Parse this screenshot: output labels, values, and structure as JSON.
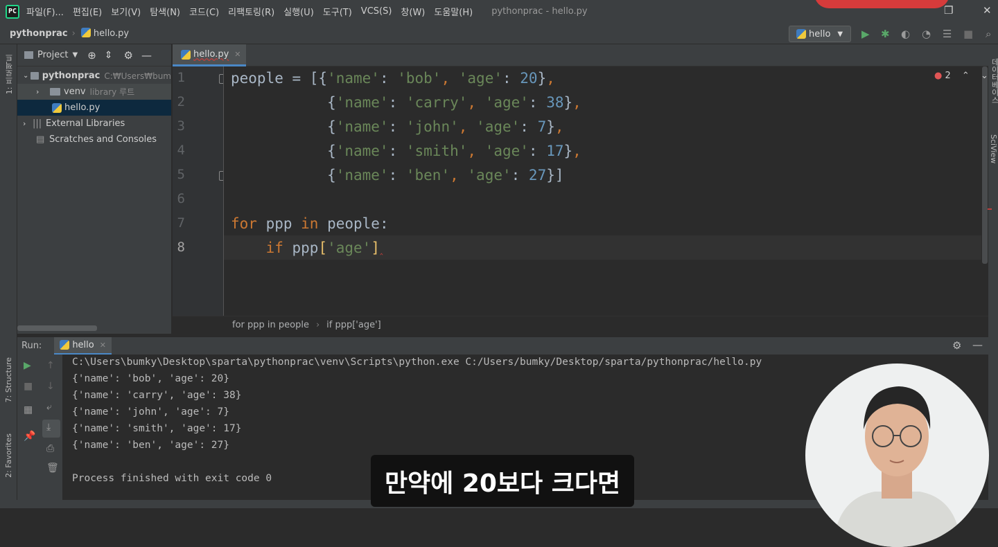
{
  "menu": {
    "app_icon": "PC",
    "items": [
      "파일(F)...",
      "편집(E)",
      "보기(V)",
      "탐색(N)",
      "코드(C)",
      "리팩토링(R)",
      "실행(U)",
      "도구(T)",
      "VCS(S)",
      "창(W)",
      "도움말(H)"
    ],
    "window_title": "pythonprac - hello.py"
  },
  "nav": {
    "project": "pythonprac",
    "file": "hello.py",
    "run_config": "hello"
  },
  "project_panel": {
    "title": "Project",
    "tree": [
      {
        "label": "pythonprac",
        "hint": "C:₩Users₩bum"
      },
      {
        "label": "venv",
        "hint": "library 루트"
      },
      {
        "label": "hello.py",
        "hint": ""
      },
      {
        "label": "External Libraries",
        "hint": ""
      },
      {
        "label": "Scratches and Consoles",
        "hint": ""
      }
    ]
  },
  "side_tabs": {
    "project": "1: 프로젝트",
    "structure": "7: Structure",
    "favorites": "2: Favorites",
    "database": "데이터베이스",
    "sciview": "SciView"
  },
  "editor": {
    "tab": "hello.py",
    "error_count": "2",
    "line_numbers": [
      "1",
      "2",
      "3",
      "4",
      "5",
      "6",
      "7",
      "8"
    ],
    "breadcrumb": [
      "for ppp in people",
      "if ppp['age']"
    ]
  },
  "run": {
    "label": "Run:",
    "tab": "hello",
    "console": [
      "C:\\Users\\bumky\\Desktop\\sparta\\pythonprac\\venv\\Scripts\\python.exe C:/Users/bumky/Desktop/sparta/pythonprac/hello.py",
      "{'name': 'bob', 'age': 20}",
      "{'name': 'carry', 'age': 38}",
      "{'name': 'john', 'age': 7}",
      "{'name': 'smith', 'age': 17}",
      "{'name': 'ben', 'age': 27}",
      "",
      "Process finished with exit code 0"
    ]
  },
  "subtitle": "만약에 20보다 크다면",
  "colors": {
    "keyword": "#cc7832",
    "string": "#6a8759",
    "number": "#6897bb",
    "accent": "#4a88c7"
  }
}
